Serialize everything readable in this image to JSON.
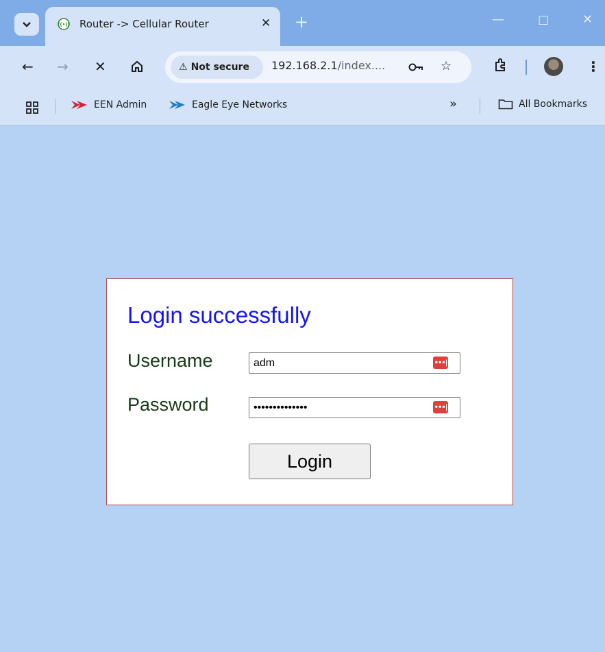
{
  "browser": {
    "tab": {
      "title": "Router -> Cellular Router"
    },
    "new_tab_glyph": "+",
    "omnibox": {
      "security_label": "Not secure",
      "url_host": "192.168.2.1",
      "url_rest": "/index...."
    },
    "bookmarks": [
      {
        "label": "EEN Admin"
      },
      {
        "label": "Eagle Eye Networks"
      }
    ],
    "overflow_glyph": "»",
    "all_bookmarks_label": "All Bookmarks"
  },
  "login": {
    "title": "Login successfully",
    "username_label": "Username",
    "username_value": "adm",
    "password_label": "Password",
    "password_value": "••••••••••••••",
    "button_label": "Login"
  },
  "colors": {
    "page_background": "#b5d2f5",
    "title_color": "#1515f0",
    "label_color": "#173a17",
    "box_border": "#b54a4a",
    "password_manager_icon": "#e0403a"
  }
}
